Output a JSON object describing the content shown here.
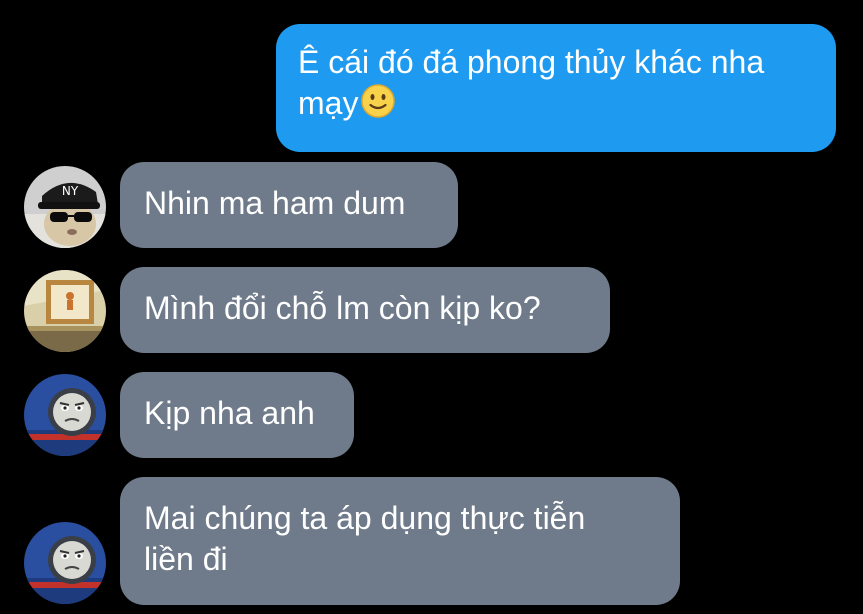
{
  "messages": [
    {
      "direction": "outgoing",
      "lines": [
        "Ê cái đó đá phong thủy khác nha",
        "mạy"
      ],
      "emoji": "slightly-smiling-face-emoji"
    },
    {
      "direction": "incoming",
      "lines": [
        "Nhin ma ham dum"
      ],
      "avatar": "cat-sunglasses-ny-cap-avatar"
    },
    {
      "direction": "incoming",
      "lines": [
        "Mình đổi chỗ lm còn kịp ko?"
      ],
      "avatar": "framed-picture-room-avatar"
    },
    {
      "direction": "incoming",
      "lines": [
        "Kịp nha anh"
      ],
      "avatar": "grumpy-train-face-avatar"
    },
    {
      "direction": "incoming",
      "lines": [
        "Mai chúng ta áp dụng thực tiễn",
        "liền đi"
      ],
      "avatar": "grumpy-train-face-avatar"
    }
  ],
  "colors": {
    "background": "#000000",
    "outgoing_bubble": "#1e9bf0",
    "incoming_bubble": "#6f7b8a",
    "text": "#ffffff"
  }
}
